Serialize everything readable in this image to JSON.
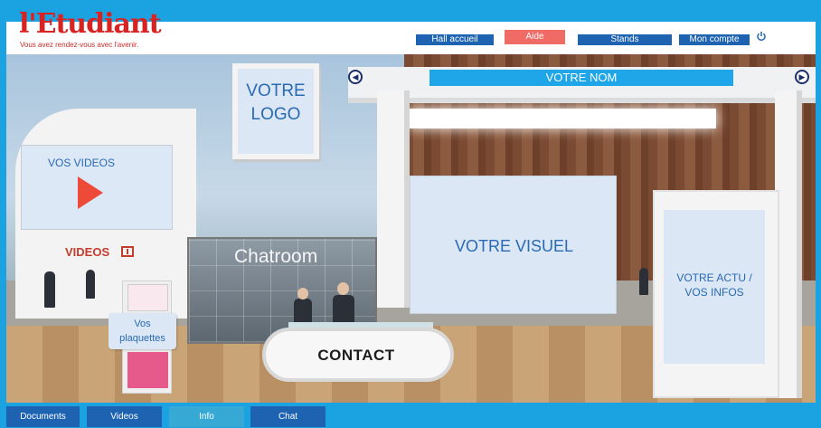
{
  "brand": {
    "name": "l'Etudiant",
    "tagline": "Vous avez rendez-vous avec l'avenir."
  },
  "nav": {
    "hall": "Hall accueil",
    "aide": "Aide",
    "stands": "Stands",
    "account": "Mon compte",
    "power_icon": "power-icon"
  },
  "stand": {
    "logo_line1": "VOTRE",
    "logo_line2": "LOGO",
    "name_banner": "VOTRE NOM",
    "videos_screen_title": "VOS VIDEOS",
    "videos_label": "VIDEOS",
    "chatroom": "Chatroom",
    "visual": "VOTRE VISUEL",
    "actu_line1": "VOTRE ACTU /",
    "actu_line2": "VOS INFOS",
    "contact": "CONTACT",
    "plaquettes_line1": "Vos",
    "plaquettes_line2": "plaquettes"
  },
  "tabs": {
    "documents": "Documents",
    "videos": "Videos",
    "info": "Info",
    "chat": "Chat"
  },
  "colors": {
    "frame_blue": "#1aa3e0",
    "nav_blue": "#1e63b2",
    "aide_red": "#f06a66",
    "brand_red": "#d92323",
    "banner_blue": "#1ea6e8",
    "text_blue": "#2a6ab4"
  }
}
